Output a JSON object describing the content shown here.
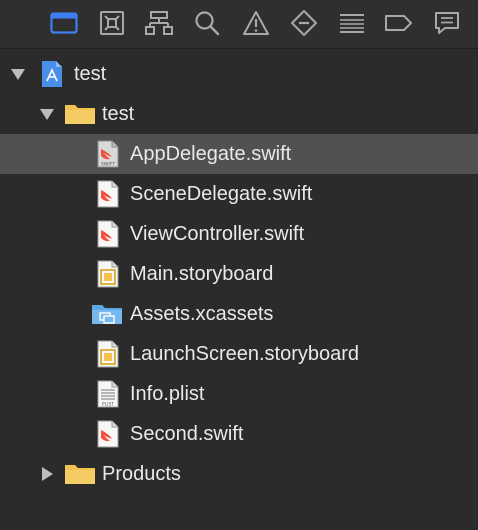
{
  "toolbar": {
    "items": [
      {
        "name": "project-navigator-icon",
        "active": true
      },
      {
        "name": "source-control-navigator-icon",
        "active": false
      },
      {
        "name": "symbol-navigator-icon",
        "active": false
      },
      {
        "name": "find-navigator-icon",
        "active": false
      },
      {
        "name": "issue-navigator-icon",
        "active": false
      },
      {
        "name": "test-navigator-icon",
        "active": false
      },
      {
        "name": "debug-navigator-icon",
        "active": false
      },
      {
        "name": "breakpoint-navigator-icon",
        "active": false
      },
      {
        "name": "report-navigator-icon",
        "active": false
      }
    ]
  },
  "tree": {
    "project": {
      "label": "test",
      "expanded": true,
      "icon": "xcode-project-icon"
    },
    "group": {
      "label": "test",
      "expanded": true,
      "icon": "folder-icon"
    },
    "files": [
      {
        "label": "AppDelegate.swift",
        "icon": "swift-file-icon",
        "selected": true
      },
      {
        "label": "SceneDelegate.swift",
        "icon": "swift-file-icon",
        "selected": false
      },
      {
        "label": "ViewController.swift",
        "icon": "swift-file-icon",
        "selected": false
      },
      {
        "label": "Main.storyboard",
        "icon": "storyboard-file-icon",
        "selected": false
      },
      {
        "label": "Assets.xcassets",
        "icon": "asset-catalog-icon",
        "selected": false
      },
      {
        "label": "LaunchScreen.storyboard",
        "icon": "storyboard-file-icon",
        "selected": false
      },
      {
        "label": "Info.plist",
        "icon": "plist-file-icon",
        "selected": false
      },
      {
        "label": "Second.swift",
        "icon": "swift-file-icon",
        "selected": false
      }
    ],
    "products": {
      "label": "Products",
      "expanded": false,
      "icon": "folder-icon"
    }
  },
  "icon_text": {
    "swift_tag": "SWIFT",
    "plist_tag": "PLIST"
  },
  "colors": {
    "background": "#2b2b2b",
    "selection": "#515151",
    "active_tool": "#3f7df0",
    "inactive_tool": "#a8a8a8",
    "folder": "#f2c14e",
    "swift_orange": "#f05138",
    "asset_blue": "#5aa8e6",
    "project_blue": "#4a8fe7"
  }
}
